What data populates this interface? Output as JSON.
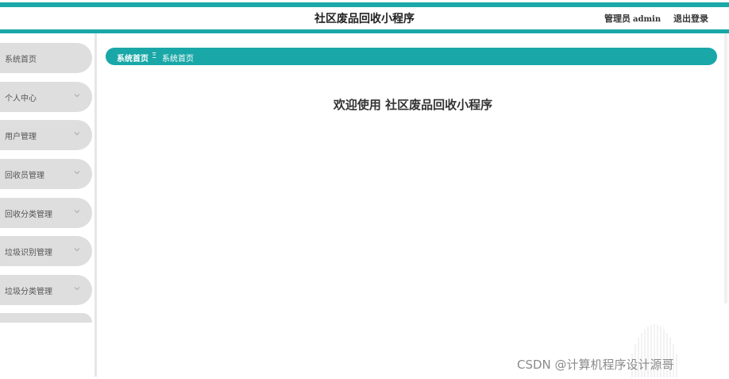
{
  "header": {
    "title": "社区废品回收小程序",
    "user_role": "管理员",
    "user_name": "admin",
    "logout_label": "退出登录"
  },
  "sidebar": {
    "items": [
      {
        "label": "系统首页"
      },
      {
        "label": "个人中心"
      },
      {
        "label": "用户管理"
      },
      {
        "label": "回收员管理"
      },
      {
        "label": "回收分类管理"
      },
      {
        "label": "垃圾识别管理"
      },
      {
        "label": "垃圾分类管理"
      },
      {
        "label": ""
      }
    ]
  },
  "breadcrumb": {
    "home": "系统首页",
    "separator": "Ξ",
    "current": "系统首页"
  },
  "main": {
    "welcome": "欢迎使用 社区废品回收小程序"
  },
  "watermark": "CSDN @计算机程序设计源哥",
  "colors": {
    "accent": "#1aa7a7",
    "menu_bg": "#dedede"
  }
}
